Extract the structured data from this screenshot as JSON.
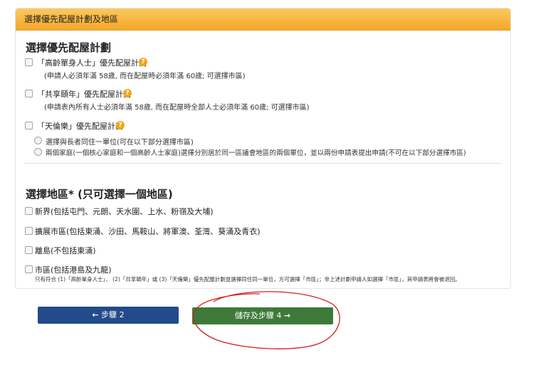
{
  "panel": {
    "header": "選擇優先配屋計劃及地區",
    "section1_title": "選擇優先配屋計劃",
    "schemes": [
      {
        "label": "「高齡單身人士」優先配屋計劃",
        "note": "(申請人必須年滿 58歲, 而在配屋時必須年滿 60歲; 可選擇市區)",
        "checked": false
      },
      {
        "label": "「共享頤年」優先配屋計劃",
        "note": "(申請表內所有人士必須年滿 58歲, 而在配屋時全部人士必須年滿 60歲; 可選擇市區)",
        "checked": false
      },
      {
        "label": "「天倫樂」優先配屋計劃",
        "checked": false
      }
    ],
    "options": [
      "選擇與長者同住一單位(可在以下部分選擇市區)",
      "兩個家庭(一個核心家庭和一個高齡人士家庭)選擇分別居於同一區議會地區的兩個單位，並以兩份申請表提出申請(不可在以下部分選擇市區)"
    ],
    "section2_title": "選擇地區* (只可選擇一個地區)",
    "districts": [
      {
        "label": "新界(包括屯門、元朗、天水圍、上水、粉嶺及大埔)",
        "checked": false
      },
      {
        "label": "擴展市區(包括東涌、沙田、馬鞍山、將軍澳、荃灣、葵涌及青衣)",
        "checked": false
      },
      {
        "label": "離島(不包括東涌)",
        "checked": false
      },
      {
        "label": "市區(包括港島及九龍)",
        "checked": false
      }
    ],
    "urban_note": "只有符合 (1)「高齡單身人士」、 (2)「共享頤年」或 (3)「天倫樂」優先配屋計劃並選擇同住同一單位，方可選擇「市區」；非上述計劃申請人如選擇「市區」，其申請表將會被退回。"
  },
  "buttons": {
    "prev": "步驟 2",
    "next": "儲存及步驟 4"
  },
  "icons": {
    "help": "help-icon",
    "prev_arrow": "arrow-left-icon",
    "next_arrow": "arrow-right-icon"
  },
  "colors": {
    "header": "#f4a829",
    "prev_button": "#234a8a",
    "next_button": "#3d7a3a",
    "annotation": "#d42020"
  }
}
